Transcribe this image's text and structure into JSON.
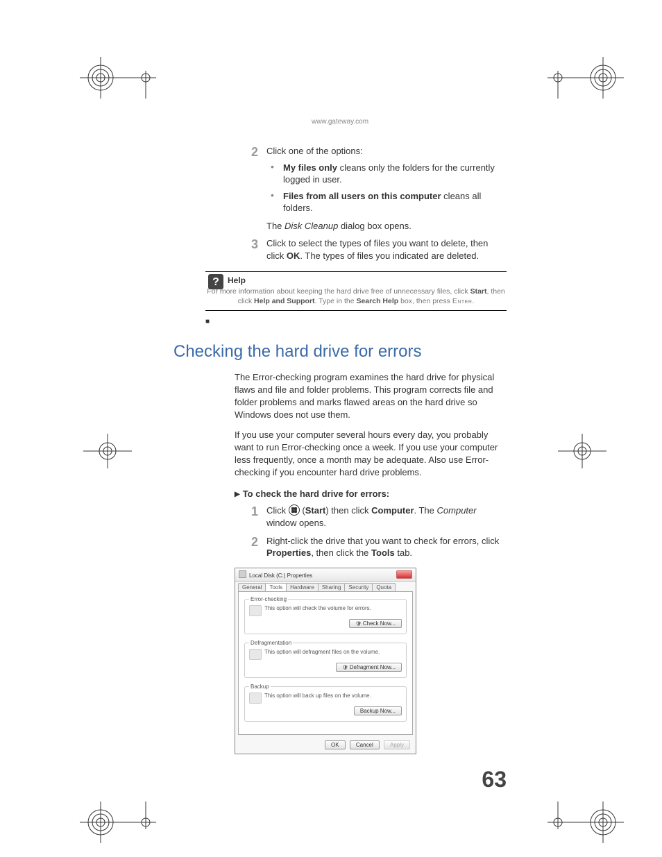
{
  "header_url": "www.gateway.com",
  "step2": {
    "num": "2",
    "text": "Click one of the options:",
    "bullet1_bold": "My files only",
    "bullet1_rest": " cleans only the folders for the currently logged in user.",
    "bullet2_bold": "Files from all users on this computer",
    "bullet2_rest": " cleans all folders.",
    "followup_pre": "The ",
    "followup_italic": "Disk Cleanup",
    "followup_post": " dialog box opens."
  },
  "step3": {
    "num": "3",
    "text_pre": "Click to select the types of files you want to delete, then click ",
    "text_bold": "OK",
    "text_post": ". The types of files you indicated are deleted."
  },
  "help": {
    "title": "Help",
    "line1_pre": "For more information about keeping the hard drive free of unnecessary files, click ",
    "start": "Start",
    "line1_mid": ", then click ",
    "hs": "Help and Support",
    "line1_post": ". Type in the ",
    "sh": "Search Help",
    "line1_end": " box, then press ",
    "enter": "Enter",
    "period": "."
  },
  "section_heading": "Checking the hard drive for errors",
  "para1": "The Error-checking program examines the hard drive for physical flaws and file and folder problems. This program corrects file and folder problems and marks flawed areas on the hard drive so Windows does not use them.",
  "para2": "If you use your computer several hours every day, you probably want to run Error-checking once a week. If you use your computer less frequently, once a month may be adequate. Also use Error-checking if you encounter hard drive problems.",
  "subhead": "To check the hard drive for errors:",
  "cstep1": {
    "num": "1",
    "pre": "Click ",
    "start": "Start",
    "mid1": ") then click ",
    "computer": "Computer",
    "mid2": ". The ",
    "comp_italic": "Computer",
    "post": " window opens."
  },
  "cstep2": {
    "num": "2",
    "pre": "Right-click the drive that you want to check for errors, click ",
    "props": "Properties",
    "mid": ", then click the ",
    "tools": "Tools",
    "post": " tab."
  },
  "dialog": {
    "title": "Local Disk (C:) Properties",
    "tabs": [
      "General",
      "Tools",
      "Hardware",
      "Sharing",
      "Security",
      "Quota"
    ],
    "grp1_legend": "Error-checking",
    "grp1_text": "This option will check the volume for errors.",
    "grp1_btn": "Check Now...",
    "grp2_legend": "Defragmentation",
    "grp2_text": "This option will defragment files on the volume.",
    "grp2_btn": "Defragment Now...",
    "grp3_legend": "Backup",
    "grp3_text": "This option will back up files on the volume.",
    "grp3_btn": "Backup Now...",
    "ok": "OK",
    "cancel": "Cancel",
    "apply": "Apply"
  },
  "page_number": "63"
}
